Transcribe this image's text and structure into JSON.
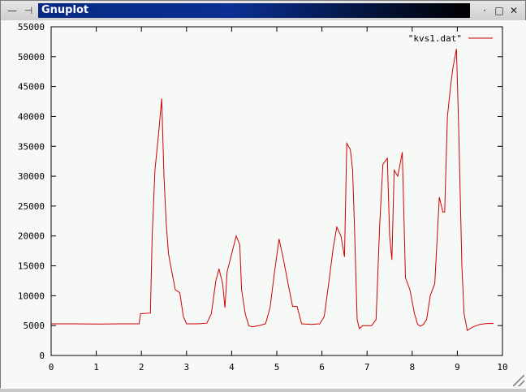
{
  "window": {
    "title": "Gnuplot",
    "icons": [
      "minus-icon",
      "pin-icon",
      "maximize-icon",
      "close-icon"
    ]
  },
  "chart_data": {
    "type": "line",
    "title": "",
    "xlabel": "",
    "ylabel": "",
    "xlim": [
      0,
      10
    ],
    "ylim": [
      0,
      55000
    ],
    "xticks": [
      "0",
      "1",
      "2",
      "3",
      "4",
      "5",
      "6",
      "7",
      "8",
      "9",
      "10"
    ],
    "yticks": [
      "0",
      "5000",
      "10000",
      "15000",
      "20000",
      "25000",
      "30000",
      "35000",
      "40000",
      "45000",
      "50000",
      "55000"
    ],
    "grid": false,
    "legend": "top-right",
    "series": [
      {
        "name": "\"kvs1.dat\"",
        "color": "#d00000",
        "points": [
          [
            0.0,
            5300
          ],
          [
            0.5,
            5300
          ],
          [
            1.0,
            5250
          ],
          [
            1.5,
            5300
          ],
          [
            1.95,
            5300
          ],
          [
            1.98,
            7000
          ],
          [
            2.2,
            7100
          ],
          [
            2.24,
            20000
          ],
          [
            2.3,
            31000
          ],
          [
            2.38,
            37000
          ],
          [
            2.45,
            43000
          ],
          [
            2.5,
            30000
          ],
          [
            2.55,
            22000
          ],
          [
            2.6,
            17000
          ],
          [
            2.65,
            15000
          ],
          [
            2.7,
            13000
          ],
          [
            2.75,
            11000
          ],
          [
            2.85,
            10500
          ],
          [
            2.93,
            6500
          ],
          [
            3.0,
            5300
          ],
          [
            3.25,
            5300
          ],
          [
            3.45,
            5400
          ],
          [
            3.55,
            7000
          ],
          [
            3.65,
            12500
          ],
          [
            3.72,
            14500
          ],
          [
            3.8,
            12000
          ],
          [
            3.85,
            8000
          ],
          [
            3.9,
            14000
          ],
          [
            4.0,
            17000
          ],
          [
            4.1,
            20000
          ],
          [
            4.18,
            18500
          ],
          [
            4.22,
            11000
          ],
          [
            4.3,
            7000
          ],
          [
            4.38,
            5000
          ],
          [
            4.45,
            4800
          ],
          [
            4.6,
            5000
          ],
          [
            4.75,
            5300
          ],
          [
            4.85,
            8000
          ],
          [
            4.95,
            14000
          ],
          [
            5.05,
            19500
          ],
          [
            5.15,
            16000
          ],
          [
            5.25,
            12000
          ],
          [
            5.35,
            8200
          ],
          [
            5.45,
            8200
          ],
          [
            5.55,
            5300
          ],
          [
            5.75,
            5200
          ],
          [
            5.95,
            5300
          ],
          [
            6.05,
            6500
          ],
          [
            6.15,
            12000
          ],
          [
            6.25,
            18000
          ],
          [
            6.33,
            21500
          ],
          [
            6.42,
            20000
          ],
          [
            6.5,
            16500
          ],
          [
            6.55,
            35500
          ],
          [
            6.63,
            34500
          ],
          [
            6.68,
            31000
          ],
          [
            6.72,
            22000
          ],
          [
            6.78,
            6000
          ],
          [
            6.83,
            4500
          ],
          [
            6.9,
            5000
          ],
          [
            7.1,
            5000
          ],
          [
            7.2,
            6000
          ],
          [
            7.28,
            22000
          ],
          [
            7.35,
            32000
          ],
          [
            7.45,
            33000
          ],
          [
            7.5,
            20000
          ],
          [
            7.55,
            16000
          ],
          [
            7.6,
            31000
          ],
          [
            7.68,
            30000
          ],
          [
            7.72,
            31500
          ],
          [
            7.78,
            34000
          ],
          [
            7.85,
            13000
          ],
          [
            7.95,
            11000
          ],
          [
            8.05,
            7000
          ],
          [
            8.12,
            5200
          ],
          [
            8.18,
            4900
          ],
          [
            8.25,
            5200
          ],
          [
            8.32,
            6000
          ],
          [
            8.4,
            10000
          ],
          [
            8.5,
            12000
          ],
          [
            8.6,
            26500
          ],
          [
            8.68,
            24000
          ],
          [
            8.72,
            24000
          ],
          [
            8.78,
            40000
          ],
          [
            8.85,
            45000
          ],
          [
            8.9,
            48000
          ],
          [
            8.98,
            51300
          ],
          [
            9.03,
            38000
          ],
          [
            9.1,
            15000
          ],
          [
            9.15,
            7000
          ],
          [
            9.22,
            4200
          ],
          [
            9.35,
            4800
          ],
          [
            9.5,
            5200
          ],
          [
            9.65,
            5350
          ],
          [
            9.8,
            5350
          ]
        ]
      }
    ]
  }
}
